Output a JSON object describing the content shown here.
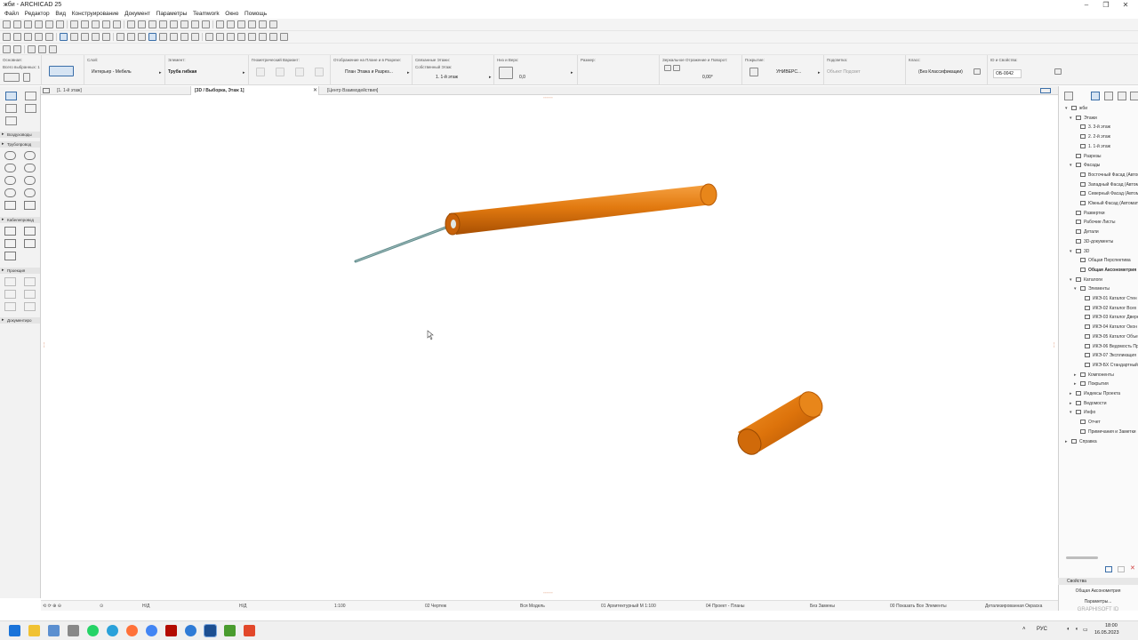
{
  "window": {
    "title": "жби - ARCHICAD 25",
    "minimize": "–",
    "maximize": "❐",
    "close": "✕"
  },
  "menu": [
    "Файл",
    "Редактор",
    "Вид",
    "Конструирование",
    "Документ",
    "Параметры",
    "Teamwork",
    "Окно",
    "Помощь"
  ],
  "infobox": {
    "osnovnaya": "Основная:",
    "vsego_vybrano": "Всего выбранных: 1",
    "sloy_label": "Слой:",
    "sloy_value": "Интерьер - Мебель",
    "element_label": "Элемент:",
    "element_value": "Труба гибкая",
    "geom_label": "Геометрический Вариант:",
    "otobr_label": "Отображение на Плане и в Разрезе:",
    "otobr_value": "План Этажа и Разрез...",
    "etazhi_label": "Связанные Этажи:",
    "etazhi_own": "Собственный Этаж:",
    "etazhi_value": "1. 1-й этаж",
    "niz_label": "Низ и Верх:",
    "niz_value": "0,0",
    "razmer_label": "Размер:",
    "mirror_label": "Зеркальное Отражение и Поворот:",
    "mirror_value": "0,00°",
    "pokrytie_label": "Покрытие:",
    "pokrytie_value": "УНИВЕРС...",
    "podsvetka_label": "Подсветка:",
    "podsvetka_value": "Объект Подсвет",
    "klass_label": "Класс:",
    "klass_value": "(Без Классификации)",
    "id_label": "ID и Свойства:",
    "id_value": "ОБ-0042"
  },
  "tabs": [
    {
      "label": "[1. 1-й этаж]"
    },
    {
      "label": "[3D / Выборка, Этаж 1]"
    },
    {
      "label": "[Центр Взаимодействия]"
    }
  ],
  "tab_close": "✕",
  "left_sections": [
    "Воздуховоды",
    "Трубопровод",
    "Кабелепровод",
    "Проекция",
    "Документиро"
  ],
  "navigator": {
    "items": [
      {
        "label": "жби",
        "depth": 0,
        "expand": "▾"
      },
      {
        "label": "Этажи",
        "depth": 1,
        "expand": "▾"
      },
      {
        "label": "3. 3-й этаж",
        "depth": 2
      },
      {
        "label": "2. 2-й этаж",
        "depth": 2
      },
      {
        "label": "1. 1-й этаж",
        "depth": 2
      },
      {
        "label": "Разрезы",
        "depth": 1
      },
      {
        "label": "Фасады",
        "depth": 1,
        "expand": "▾"
      },
      {
        "label": "Восточный Фасад (Автом",
        "depth": 2
      },
      {
        "label": "Западный Фасад (Автом",
        "depth": 2
      },
      {
        "label": "Северный Фасад (Автом",
        "depth": 2
      },
      {
        "label": "Южный Фасад (Автомат",
        "depth": 2
      },
      {
        "label": "Развертки",
        "depth": 1
      },
      {
        "label": "Рабочие Листы",
        "depth": 1
      },
      {
        "label": "Детали",
        "depth": 1
      },
      {
        "label": "3D-документы",
        "depth": 1
      },
      {
        "label": "3D",
        "depth": 1,
        "expand": "▾"
      },
      {
        "label": "Общая Перспектива",
        "depth": 2
      },
      {
        "label": "Общая Аксонометрия",
        "depth": 2,
        "selected": true
      },
      {
        "label": "Каталоги",
        "depth": 1,
        "expand": "▾"
      },
      {
        "label": "Элементы",
        "depth": 2,
        "expand": "▾"
      },
      {
        "label": "ИКЭ-01 Каталог Стен",
        "depth": 3
      },
      {
        "label": "ИКЭ-02 Каталог Всех П",
        "depth": 3
      },
      {
        "label": "ИКЭ-03 Каталог Двере",
        "depth": 3
      },
      {
        "label": "ИКЭ-04 Каталог Окон",
        "depth": 3
      },
      {
        "label": "ИКЭ-05 Каталог Объек",
        "depth": 3
      },
      {
        "label": "ИКЭ-06 Ведомость Пр",
        "depth": 3
      },
      {
        "label": "ИКЭ-07 Экспликация",
        "depth": 3
      },
      {
        "label": "ИКЭ-БХ Стандартный",
        "depth": 3
      },
      {
        "label": "Компоненты",
        "depth": 2,
        "expand": "▸"
      },
      {
        "label": "Покрытия",
        "depth": 2,
        "expand": "▸"
      },
      {
        "label": "Индексы Проекта",
        "depth": 1,
        "expand": "▸"
      },
      {
        "label": "Ведомости",
        "depth": 1,
        "expand": "▸"
      },
      {
        "label": "Инфо",
        "depth": 1,
        "expand": "▾"
      },
      {
        "label": "Отчет",
        "depth": 2
      },
      {
        "label": "Примечания и Заметки",
        "depth": 2
      },
      {
        "label": "Справка",
        "depth": 0,
        "expand": "▸"
      }
    ]
  },
  "properties": {
    "header": "Свойства",
    "view_name": "Общая Аксонометрия",
    "params_button": "Параметры...",
    "brand": "GRAPHISOFT ID"
  },
  "statusbar": {
    "nd1": "Н/Д",
    "nd2": "Н/Д",
    "scale": "1:100",
    "drawing": "02 Чертеж",
    "model": "Вся Модель",
    "pen": "01 Архитектурный М 1:100",
    "project": "04 Проект - Планы",
    "override": "Без Замены",
    "show": "00 Показать Все Элементы",
    "coloring": "Детализированная Окраска"
  },
  "tray": {
    "lang": "РУС",
    "time": "18:00",
    "date": "16.05.2023"
  },
  "colors": {
    "pipe": "#e0760a",
    "pipe_dark": "#b85a05",
    "cable": "#5f8a8a",
    "accent": "#3a6ea8",
    "taskbar": "#f0f0f0"
  },
  "icons": [
    "search-icon",
    "gear-icon",
    "close-icon",
    "windows-start-icon",
    "folder-icon",
    "whatsapp-icon",
    "telegram-icon",
    "firefox-icon",
    "chrome-icon",
    "acrobat-icon",
    "archicad-icon"
  ]
}
